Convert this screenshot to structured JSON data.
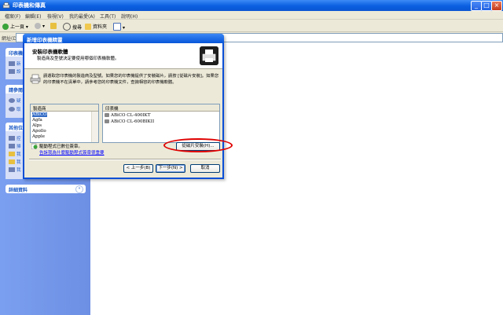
{
  "window": {
    "title": "印表機和傳真",
    "minimize": "_",
    "maximize": "□",
    "close": "×"
  },
  "menu": [
    "檔案(F)",
    "編輯(E)",
    "檢視(V)",
    "我的最愛(A)",
    "工具(T)",
    "說明(H)"
  ],
  "toolbar": {
    "back": "上一頁",
    "search": "搜尋",
    "folders": "資料夾"
  },
  "address": {
    "label": "網址(D)"
  },
  "sidebar": {
    "group1": {
      "title": "印表機",
      "items": [
        "新",
        "設"
      ]
    },
    "group2": {
      "title": "請參閱",
      "items": [
        "疑",
        "取"
      ]
    },
    "group3": {
      "title": "其他位",
      "items": [
        "控",
        "掃",
        "我",
        "我",
        "我"
      ]
    },
    "details": "詳細資料",
    "chevron": "»"
  },
  "dialog": {
    "title": "新增印表機精靈",
    "header_title": "安裝印表機軟體",
    "header_subtitle": "製造商及型號決定要使用哪個印表機軟體。",
    "description": "請選取您印表機的製造商及型號。如果您的印表機提供了安裝磁片，請按 [從磁片安裝]。如果您的印表機不在清單中，請參考您的印表機文件，查詢相容的印表機軟體。",
    "manufacturers_header": "製造商",
    "manufacturers": [
      "ABiCO",
      "Agfa",
      "Alps",
      "Apollo",
      "Apple"
    ],
    "printers_header": "印表機",
    "printers": [
      "ABiCO CL-400IKT",
      "ABiCO CL-600BIKII"
    ],
    "signed_text": "驅動程式已數位簽章。",
    "why_link": "告訴我為什麼驅動程式簽章很重要",
    "have_disk": "從磁片安裝(H)...",
    "back": "< 上一步(B)",
    "next": "下一步(N) >",
    "cancel": "取消"
  }
}
